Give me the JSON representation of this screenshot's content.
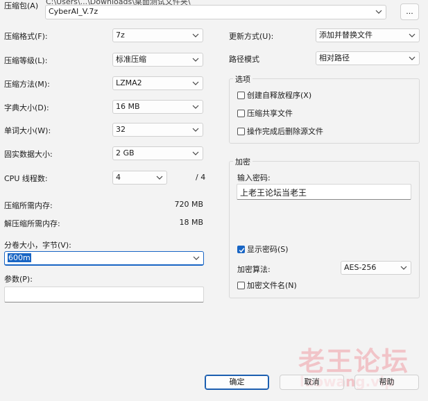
{
  "archive": {
    "label": "压缩包(A)",
    "hint": "C:\\Users\\...\\Downloads\\桌面测试文件夹\\",
    "value": "CyberAI_V.7z",
    "browse_label": "..."
  },
  "left": {
    "format": {
      "label": "压缩格式(F):",
      "value": "7z"
    },
    "level": {
      "label": "压缩等级(L):",
      "value": "标准压缩"
    },
    "method": {
      "label": "压缩方法(M):",
      "value": "LZMA2"
    },
    "dict": {
      "label": "字典大小(D):",
      "value": "16 MB"
    },
    "word": {
      "label": "单词大小(W):",
      "value": "32"
    },
    "solid": {
      "label": "固实数据大小:",
      "value": "2 GB"
    },
    "threads": {
      "label": "CPU 线程数:",
      "value": "4",
      "max": "/ 4"
    },
    "mem_compress": {
      "label": "压缩所需内存:",
      "value": "720 MB"
    },
    "mem_decompress": {
      "label": "解压缩所需内存:",
      "value": "18 MB"
    },
    "volume": {
      "label": "分卷大小，字节(V):",
      "value": "600m"
    },
    "params": {
      "label": "参数(P):",
      "value": ""
    }
  },
  "right": {
    "update_mode": {
      "label": "更新方式(U):",
      "value": "添加并替换文件"
    },
    "path_mode": {
      "label": "路径模式",
      "value": "相对路径"
    },
    "options": {
      "title": "选项",
      "sfx": "创建自释放程序(X)",
      "shared": "压缩共享文件",
      "delete_after": "操作完成后删除源文件"
    },
    "encryption": {
      "title": "加密",
      "password_label": "输入密码:",
      "password_value": "上老王论坛当老王",
      "show_password": "显示密码(S)",
      "method_label": "加密算法:",
      "method_value": "AES-256",
      "encrypt_names": "加密文件名(N)"
    }
  },
  "buttons": {
    "ok": "确定",
    "cancel": "取消",
    "help": "帮助"
  },
  "watermark": {
    "title": "老王论坛",
    "url": "laowang.vip"
  },
  "colors": {
    "accent": "#1865c4",
    "background": "#f3f3f3",
    "watermark": "#ed6e78"
  }
}
